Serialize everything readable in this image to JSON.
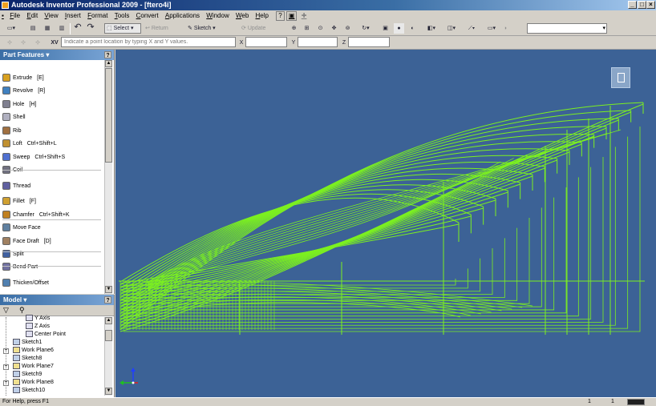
{
  "title": "Autodesk Inventor Professional 2009 - [ftero4i]",
  "menu": [
    "File",
    "Edit",
    "View",
    "Insert",
    "Format",
    "Tools",
    "Convert",
    "Applications",
    "Window",
    "Web",
    "Help"
  ],
  "toolbar": {
    "select_label": "Select",
    "return_label": "Return",
    "sketch_label": "Sketch",
    "update_label": "Update"
  },
  "inputbar": {
    "xy_label": "XV",
    "placeholder": "Indicate a point location by typing X and Y values.",
    "x_label": "X",
    "y_label": "Y",
    "z_label": "Z"
  },
  "part_features": {
    "header": "Part Features",
    "help": "?",
    "items": [
      {
        "label": "Extrude",
        "shortcut": "[E]"
      },
      {
        "label": "Revolve",
        "shortcut": "[R]"
      },
      {
        "label": "Hole",
        "shortcut": "[H]"
      },
      {
        "label": "Shell",
        "shortcut": ""
      },
      {
        "label": "Rib",
        "shortcut": ""
      },
      {
        "label": "Loft",
        "shortcut": "Ctrl+Shift+L"
      },
      {
        "label": "Sweep",
        "shortcut": "Ctrl+Shift+S"
      },
      {
        "label": "Coil",
        "shortcut": ""
      },
      {
        "label": "Thread",
        "shortcut": ""
      },
      {
        "label": "Fillet",
        "shortcut": "[F]"
      },
      {
        "label": "Chamfer",
        "shortcut": "Ctrl+Shift+K"
      },
      {
        "label": "Move Face",
        "shortcut": ""
      },
      {
        "label": "Face Draft",
        "shortcut": "[D]"
      },
      {
        "label": "Split",
        "shortcut": ""
      },
      {
        "label": "Bend Part",
        "shortcut": ""
      },
      {
        "label": "Thicken/Offset",
        "shortcut": ""
      }
    ]
  },
  "model": {
    "header": "Model",
    "help": "?",
    "tree": [
      {
        "label": "Y Axis",
        "expandable": false
      },
      {
        "label": "Z Axis",
        "expandable": false
      },
      {
        "label": "Center Point",
        "expandable": false
      },
      {
        "label": "Sketch1",
        "expandable": false
      },
      {
        "label": "Work Plane6",
        "expandable": true
      },
      {
        "label": "Sketch8",
        "expandable": false
      },
      {
        "label": "Work Plane7",
        "expandable": true
      },
      {
        "label": "Sketch9",
        "expandable": false
      },
      {
        "label": "Work Plane8",
        "expandable": true
      },
      {
        "label": "Sketch10",
        "expandable": false
      }
    ]
  },
  "viewport": {
    "background": "#3c6296",
    "wire_color": "#7cf020"
  },
  "status": {
    "help_text": "For Help, press F1",
    "count_a": "1",
    "count_b": "1"
  }
}
